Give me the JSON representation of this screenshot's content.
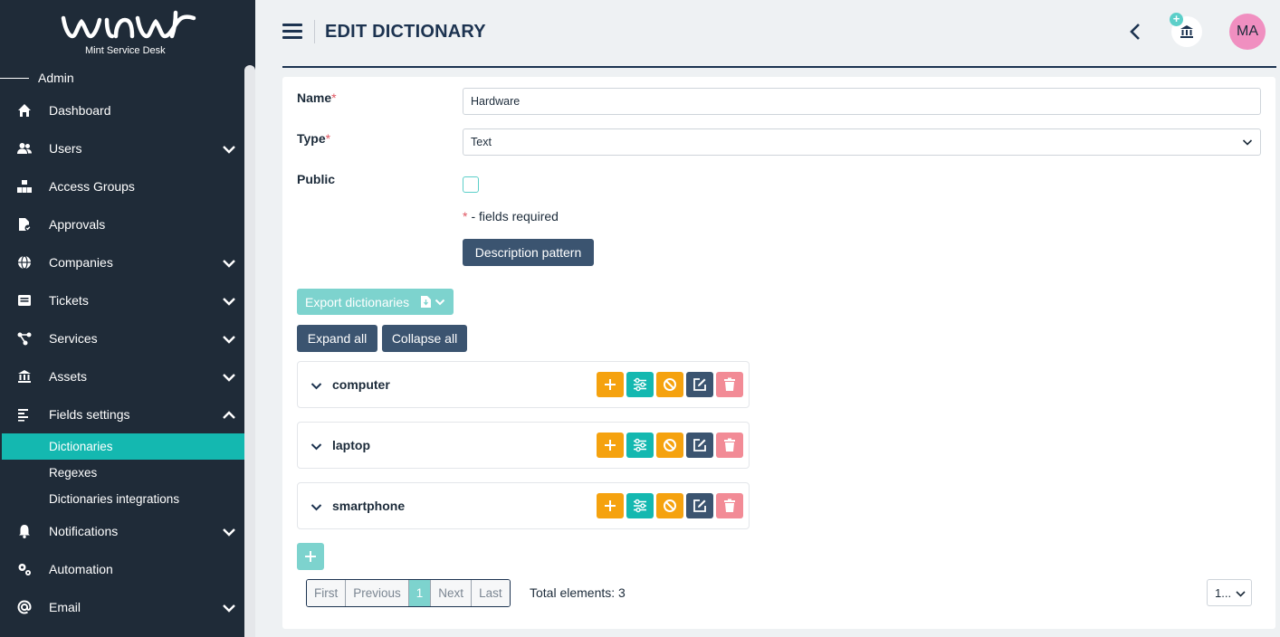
{
  "app": {
    "logo_text": "Mint Service Desk",
    "section_label": "Admin"
  },
  "sidebar": {
    "items": [
      {
        "label": "Dashboard",
        "icon": "home-icon",
        "has_chevron": false
      },
      {
        "label": "Users",
        "icon": "users-icon",
        "has_chevron": true
      },
      {
        "label": "Access Groups",
        "icon": "sitemap-icon",
        "has_chevron": false
      },
      {
        "label": "Approvals",
        "icon": "file-check-icon",
        "has_chevron": false
      },
      {
        "label": "Companies",
        "icon": "globe-icon",
        "has_chevron": true
      },
      {
        "label": "Tickets",
        "icon": "ticket-icon",
        "has_chevron": true
      },
      {
        "label": "Services",
        "icon": "share-icon",
        "has_chevron": true
      },
      {
        "label": "Assets",
        "icon": "bank-icon",
        "has_chevron": true
      },
      {
        "label": "Fields settings",
        "icon": "align-left-icon",
        "has_chevron": true,
        "expanded": true
      },
      {
        "label": "Notifications",
        "icon": "bell-icon",
        "has_chevron": true
      },
      {
        "label": "Automation",
        "icon": "cogs-icon",
        "has_chevron": false
      },
      {
        "label": "Email",
        "icon": "at-icon",
        "has_chevron": true
      }
    ],
    "sub_items": [
      {
        "label": "Dictionaries",
        "active": true
      },
      {
        "label": "Regexes",
        "active": false
      },
      {
        "label": "Dictionaries integrations",
        "active": false
      }
    ]
  },
  "header": {
    "title": "EDIT DICTIONARY",
    "avatar_initials": "MA",
    "bank_badge": "+"
  },
  "form": {
    "name_label": "Name",
    "name_value": "Hardware",
    "type_label": "Type",
    "type_value": "Text",
    "public_label": "Public",
    "public_checked": false,
    "required_marker": "*",
    "required_note": "- fields required",
    "description_button": "Description pattern"
  },
  "toolbar": {
    "export_label": "Export dictionaries",
    "expand_label": "Expand all",
    "collapse_label": "Collapse all"
  },
  "dictionary_items": [
    {
      "name": "computer"
    },
    {
      "name": "laptop"
    },
    {
      "name": "smartphone"
    }
  ],
  "pagination": {
    "first": "First",
    "previous": "Previous",
    "current": "1",
    "next": "Next",
    "last": "Last",
    "total_text": "Total elements: 3",
    "page_size": "1..."
  },
  "colors": {
    "sidebar_bg": "#1f2b38",
    "active_teal": "#14b8b0",
    "navy": "#1c3350",
    "orange": "#f5a20f",
    "danger_pink": "#f28b96"
  }
}
